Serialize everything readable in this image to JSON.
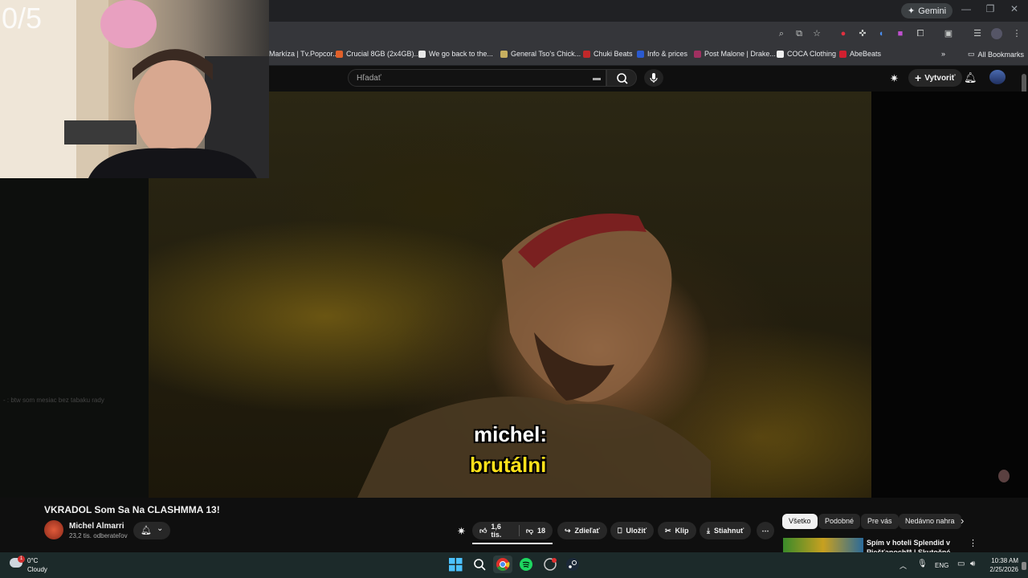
{
  "overlay": {
    "counter": "0/5"
  },
  "browser": {
    "gemini_label": "Gemini",
    "bookmarks": [
      {
        "label": "Markíza | Tv.Popcor...",
        "color": "#6a6a6a"
      },
      {
        "label": "Crucial 8GB (2x4GB)...",
        "color": "#e0602a"
      },
      {
        "label": "We go back to the...",
        "color": "#e8e8e8"
      },
      {
        "label": "General Tso's Chick...",
        "color": "#c8b060"
      },
      {
        "label": "Chuki Beats",
        "color": "#c0282a"
      },
      {
        "label": "Info & prices",
        "color": "#2a5ad0"
      },
      {
        "label": "Post Malone | Drake...",
        "color": "#a03060"
      },
      {
        "label": "COCA Clothing",
        "color": "#f0f0f0"
      },
      {
        "label": "AbeBeats",
        "color": "#d02030"
      }
    ],
    "all_bookmarks": "All Bookmarks"
  },
  "youtube": {
    "search_placeholder": "Hľadať",
    "create_label": "Vytvoriť"
  },
  "video": {
    "caption_line1": "michel:",
    "caption_line2": "brutálni",
    "chat_line": "- : btw som mesiac bez tabaku rady",
    "title": "VKRADOL Som Sa Na CLASHMMA 13!",
    "channel_name": "Michel Almarri",
    "subscribers": "23,2 tis. odberateľov",
    "likes": "1,6 tis.",
    "dislikes": "18",
    "share_label": "Zdieľať",
    "save_label": "Uložiť",
    "clip_label": "Klip",
    "download_label": "Stiahnuť"
  },
  "chips": [
    "Všetko",
    "Podobné",
    "Pre vás",
    "Nedávno nahra"
  ],
  "related": {
    "title": "Spím v hoteli Splendid v Piešťanoch** | Skutočné All..."
  },
  "taskbar": {
    "temperature": "0°C",
    "weather": "Cloudy",
    "notification_count": "1",
    "language": "ENG",
    "time": "10:38 AM",
    "date": "2/25/2026"
  }
}
